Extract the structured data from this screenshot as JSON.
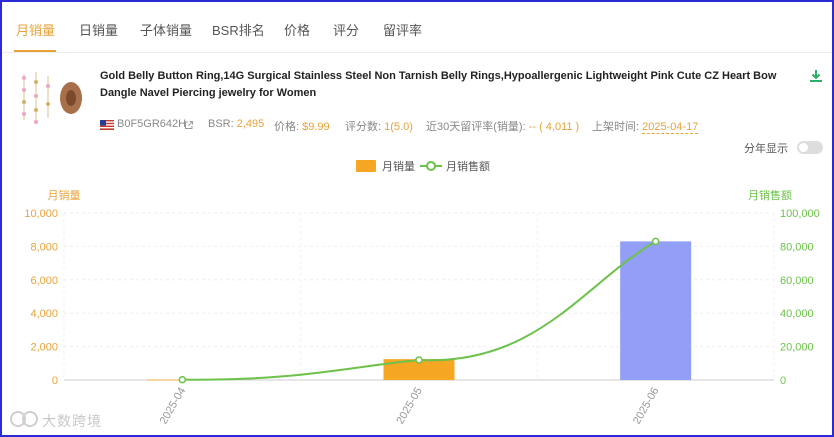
{
  "tabs": [
    "月销量",
    "日销量",
    "子体销量",
    "BSR排名",
    "价格",
    "评分",
    "留评率"
  ],
  "product": {
    "title": "Gold Belly Button Ring,14G Surgical Stainless Steel Non Tarnish Belly Rings,Hypoallergenic Lightweight Pink Cute CZ Heart Bow Dangle Navel Piercing jewelry for Women",
    "asin": "B0F5GR642H",
    "bsr_label": "BSR:",
    "bsr_value": "2,495",
    "price_label": "价格:",
    "price_value": "$9.99",
    "rating_label": "评分数:",
    "rating_value": "1(5.0)",
    "review_rate_label": "近30天留评率(销量):",
    "review_rate_value": "-- ( 4,011 )",
    "listed_label": "上架时间:",
    "listed_value": "2025-04-17"
  },
  "controls": {
    "year_toggle_label": "分年显示"
  },
  "icons": {
    "download": "download-icon",
    "flag": "us-flag-icon",
    "external": "external-link-icon"
  },
  "colors": {
    "accent": "#e8a33a",
    "bar_highlight": "#f5a623",
    "bar_alt": "#939ef7",
    "line": "#6cc24a",
    "frame": "#2b2bd6"
  },
  "watermark": "大数跨境",
  "chart_data": {
    "type": "bar",
    "categories": [
      "2025-04",
      "2025-05",
      "2025-06"
    ],
    "series": [
      {
        "name": "月销量",
        "type": "bar",
        "axis": "left",
        "values": [
          20,
          1250,
          8300
        ]
      },
      {
        "name": "月销售额",
        "type": "line",
        "axis": "right",
        "values": [
          200,
          12000,
          83000
        ]
      }
    ],
    "y_left": {
      "label": "月销量",
      "ticks": [
        "0",
        "2,000",
        "4,000",
        "6,000",
        "8,000",
        "10,000"
      ],
      "lim": [
        0,
        10000
      ]
    },
    "y_right": {
      "label": "月销售额",
      "ticks": [
        "0",
        "20,000",
        "40,000",
        "60,000",
        "80,000",
        "100,000"
      ],
      "lim": [
        0,
        100000
      ]
    },
    "legend_position": "top-center",
    "grid": true
  }
}
